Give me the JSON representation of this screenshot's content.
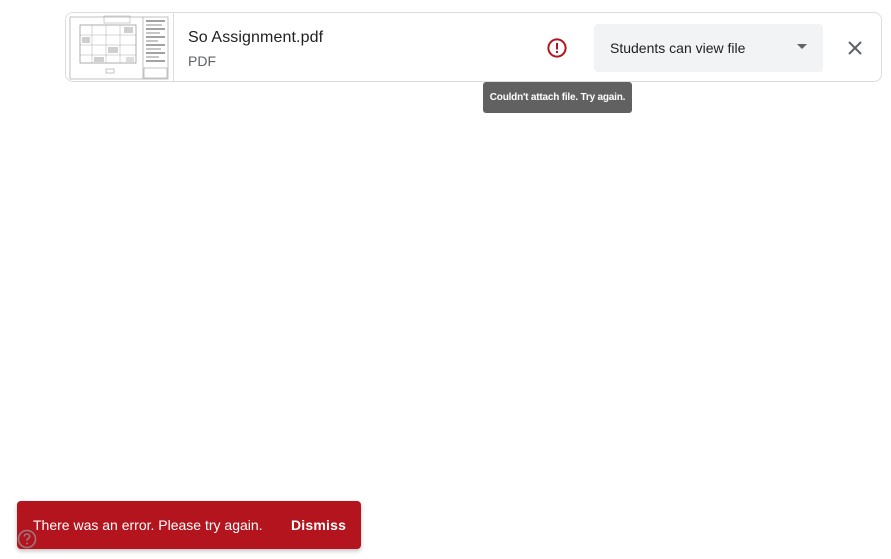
{
  "attachment": {
    "file_name": "So Assignment.pdf",
    "file_type": "PDF",
    "thumbnail_icon": "pdf-floorplan-thumbnail",
    "error_icon": "error-exclamation-icon",
    "share_setting": {
      "selected": "Students can view file"
    },
    "close_icon": "close-icon"
  },
  "tooltip": {
    "text": "Couldn't attach file. Try again."
  },
  "snackbar": {
    "message": "There was an error. Please try again.",
    "action_label": "Dismiss"
  },
  "help_icon": "help-icon",
  "colors": {
    "error_red": "#b3141d",
    "tooltip_bg": "#616161",
    "select_bg": "#f1f3f4",
    "border": "#dadce0"
  }
}
